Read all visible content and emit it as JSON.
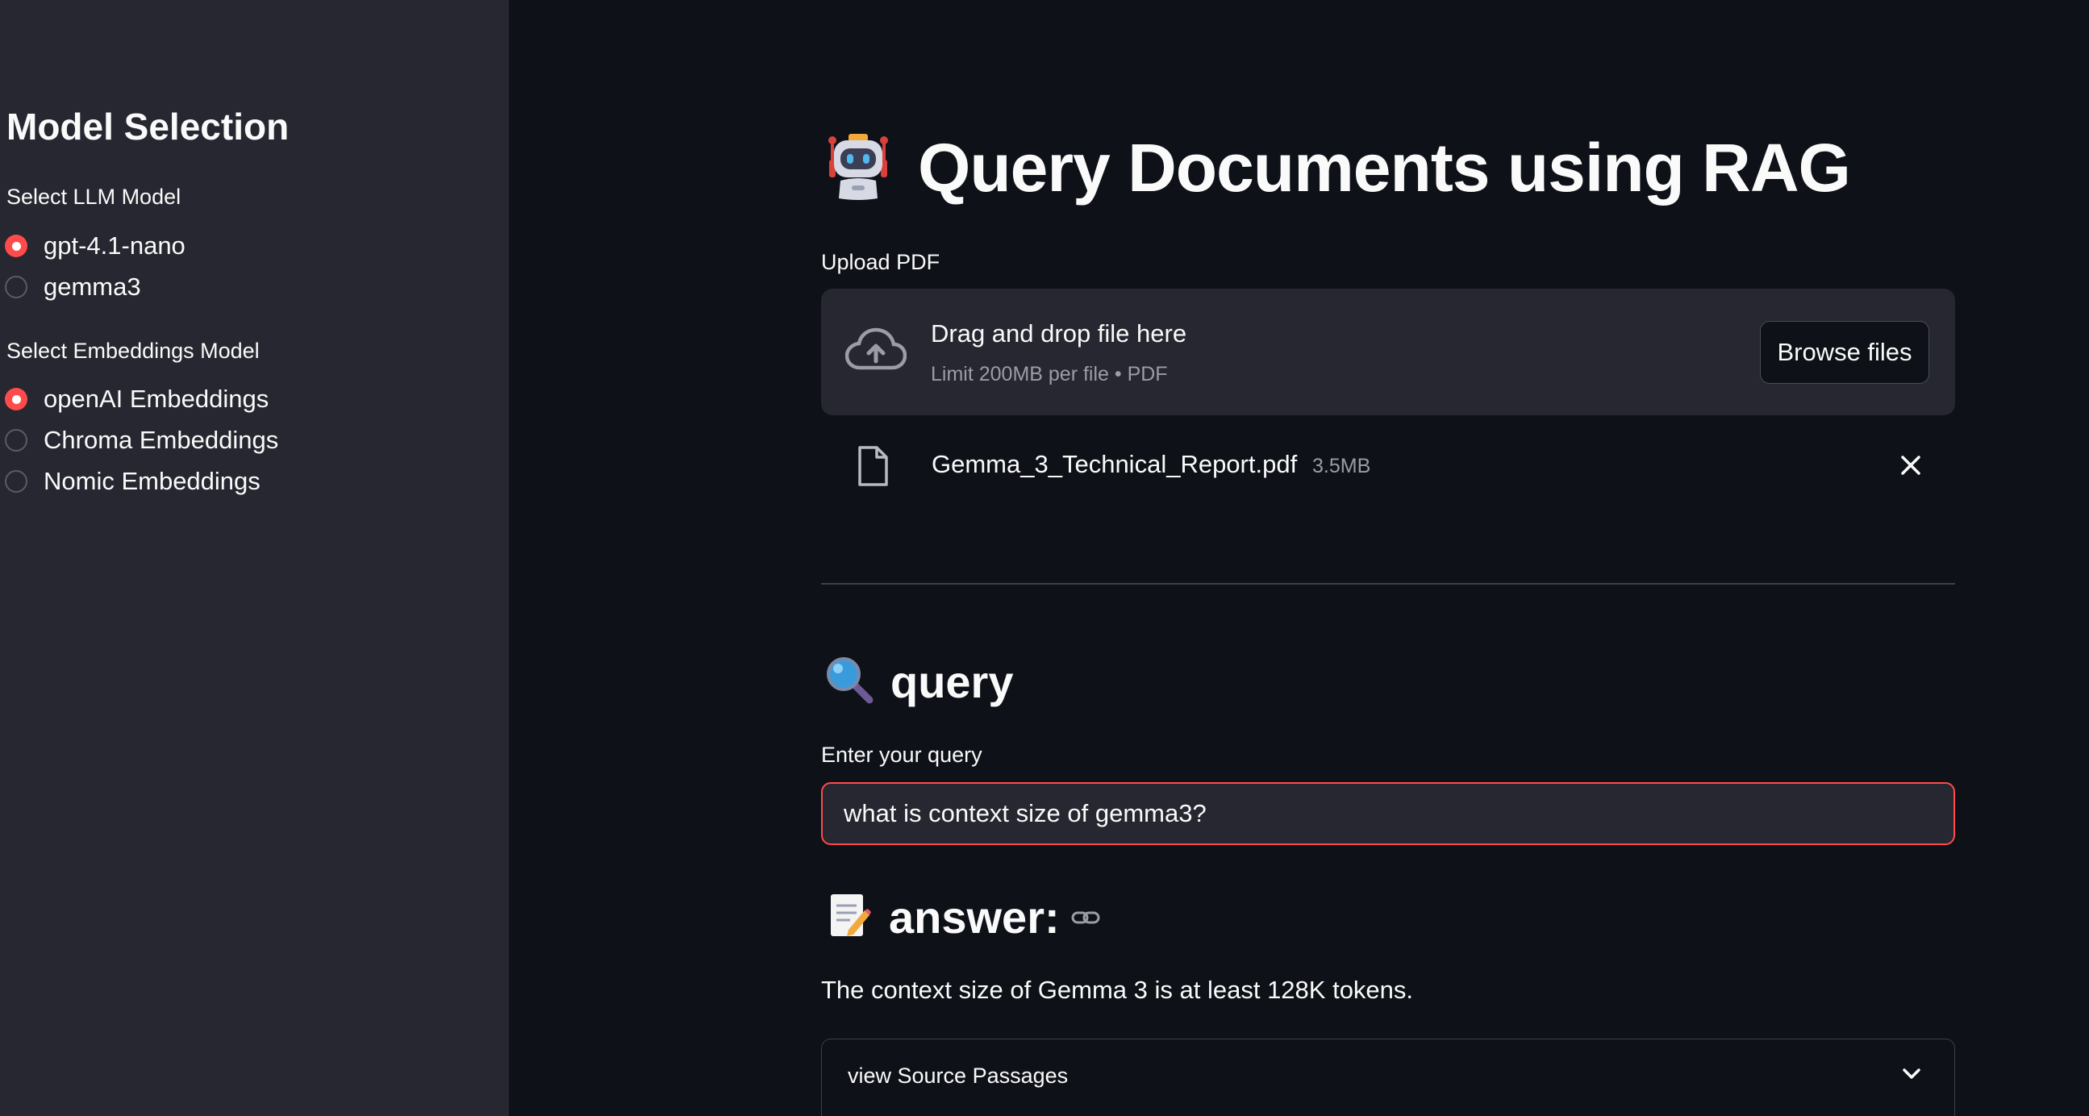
{
  "sidebar": {
    "title": "Model Selection",
    "llm_group": {
      "label": "Select LLM Model",
      "options": [
        {
          "label": "gpt-4.1-nano",
          "selected": true
        },
        {
          "label": "gemma3",
          "selected": false
        }
      ]
    },
    "embeddings_group": {
      "label": "Select Embeddings Model",
      "options": [
        {
          "label": "openAI Embeddings",
          "selected": true
        },
        {
          "label": "Chroma Embeddings",
          "selected": false
        },
        {
          "label": "Nomic Embeddings",
          "selected": false
        }
      ]
    }
  },
  "main": {
    "title": "Query Documents using RAG",
    "title_icon": "robot-icon",
    "upload": {
      "label": "Upload PDF",
      "drop_text": "Drag and drop file here",
      "limit_text": "Limit 200MB per file • PDF",
      "browse_label": "Browse files",
      "file": {
        "name": "Gemma_3_Technical_Report.pdf",
        "size": "3.5MB"
      }
    },
    "query_section": {
      "heading": "query",
      "icon": "magnifier-icon",
      "input_label": "Enter your query",
      "input_value": "what is context size of gemma3?"
    },
    "answer_section": {
      "heading": "answer:",
      "icon": "memo-icon",
      "text": "The context size of Gemma 3 is at least 128K tokens.",
      "expander_label": "view Source Passages"
    }
  },
  "colors": {
    "background": "#0e1117",
    "sidebar": "#262730",
    "accent": "#ff4b4b",
    "text": "#fafafa",
    "muted": "#9a9ca6"
  }
}
